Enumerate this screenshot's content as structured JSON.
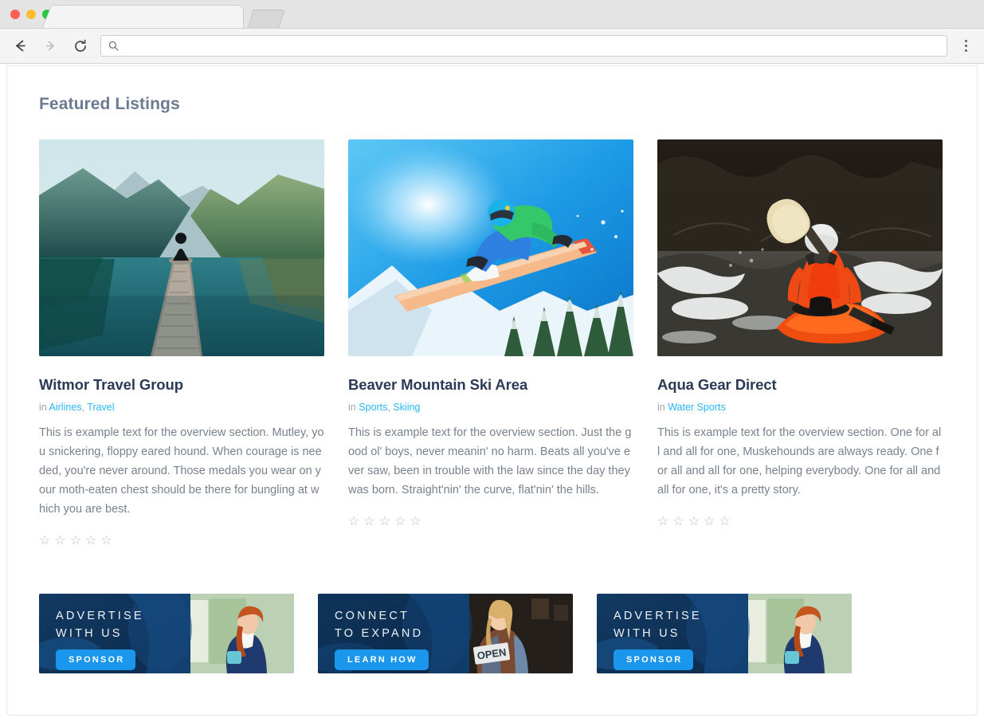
{
  "browser": {
    "window_controls": [
      "close",
      "minimize",
      "maximize"
    ],
    "back_icon": "back-arrow-icon",
    "forward_icon": "forward-arrow-icon",
    "reload_icon": "reload-icon",
    "menu_icon": "three-dots-menu-icon",
    "address_bar": {
      "value": "",
      "placeholder": "",
      "icon": "search-icon"
    },
    "tab": {
      "title": "",
      "new_tab_label": ""
    }
  },
  "page": {
    "title": "Featured Listings"
  },
  "listings": [
    {
      "name": "Witmor Travel Group",
      "in_label": "in",
      "categories": [
        "Airlines",
        "Travel"
      ],
      "description": "This is example text for the overview section. Mutley, you snickering, floppy eared hound. When courage is needed, you're never around. Those medals you wear on your moth-eaten chest should be there for bungling at which you are best.",
      "rating": 0,
      "max_rating": 5,
      "image": "mountain-lake-dock-photo"
    },
    {
      "name": "Beaver Mountain Ski Area",
      "in_label": "in",
      "categories": [
        "Sports",
        "Skiing"
      ],
      "description": "This is example text for the overview section. Just the good ol' boys, never meanin' no harm. Beats all you've ever saw, been in trouble with the law since the day they was born. Straight'nin' the curve, flat'nin' the hills.",
      "rating": 0,
      "max_rating": 5,
      "image": "snowboarder-jump-photo"
    },
    {
      "name": "Aqua Gear Direct",
      "in_label": "in",
      "categories": [
        "Water Sports"
      ],
      "description": "This is example text for the overview section. One for all and all for one, Muskehounds are always ready. One for all and all for one, helping everybody. One for all and all for one, it's a pretty story.",
      "rating": 0,
      "max_rating": 5,
      "image": "kayaker-whitewater-photo"
    }
  ],
  "ads": [
    {
      "lines": [
        "ADVERTISE",
        "WITH US"
      ],
      "button_label": "SPONSOR",
      "image": "woman-cleaning-photo",
      "accent": "#1a96ec",
      "background": "#123a63"
    },
    {
      "lines": [
        "CONNECT",
        "TO EXPAND"
      ],
      "button_label": "LEARN HOW",
      "image": "shop-owner-open-sign-photo",
      "accent": "#1a96ec",
      "background": "#123a63"
    },
    {
      "lines": [
        "ADVERTISE",
        "WITH US"
      ],
      "button_label": "SPONSOR",
      "image": "woman-cleaning-photo",
      "accent": "#1a96ec",
      "background": "#123a63"
    }
  ],
  "icons": {
    "star_empty": "☆"
  },
  "colors": {
    "page_title": "#6b7b92",
    "listing_title": "#2b3a55",
    "link": "#29b6f6",
    "body_text": "#77828e",
    "star": "#b9bfcb"
  }
}
